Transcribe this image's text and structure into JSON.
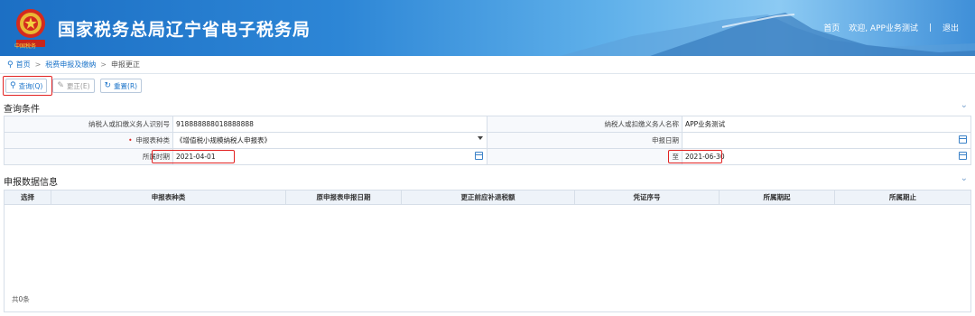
{
  "header": {
    "site_title": "国家税务总局辽宁省电子税务局",
    "emblem_text": "中国税务",
    "links": {
      "home": "首页",
      "welcome": "欢迎, APP业务测试",
      "separator": "|",
      "logout": "退出"
    }
  },
  "breadcrumb": {
    "home": "首页",
    "sep": ">",
    "level2": "税费申报及缴纳",
    "current": "申报更正"
  },
  "toolbar": {
    "query": "查询(Q)",
    "correct": "更正(E)",
    "reset": "重置(R)"
  },
  "query_section": {
    "title": "查询条件",
    "taxpayer_id_label": "纳税人或扣缴义务人识别号",
    "taxpayer_id_value": "918888888018888888",
    "taxpayer_name_label": "纳税人或扣缴义务人名称",
    "taxpayer_name_value": "APP业务测试",
    "report_type_label": "申报表种类",
    "report_type_value": "《增值税小规模纳税人申报表》",
    "report_date_label": "申报日期",
    "period_label": "所属时期",
    "period_start": "2021-04-01",
    "to_label": "至",
    "period_end": "2021-06-30"
  },
  "data_section": {
    "title": "申报数据信息",
    "columns": [
      "选择",
      "申报表种类",
      "原申报表申报日期",
      "更正前应补退税额",
      "凭证序号",
      "所属期起",
      "所属期止"
    ],
    "total": "共0条"
  },
  "colors": {
    "brand_blue": "#1a73c9",
    "highlight_red": "#e22222"
  }
}
